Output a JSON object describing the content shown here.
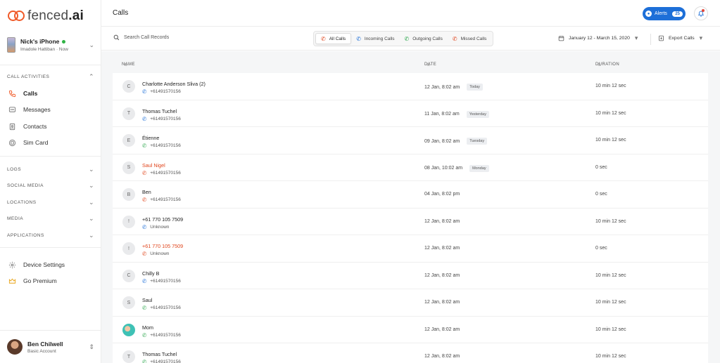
{
  "app": {
    "logo_text_light": "fenced",
    "logo_text_bold": ".ai"
  },
  "device": {
    "name": "Nick's iPhone",
    "owner": "Imadole Hattiban",
    "status": "Now"
  },
  "sidebar": {
    "call_activities_header": "CALL ACTIVITIES",
    "items": [
      {
        "label": "Calls",
        "icon": "phone-icon"
      },
      {
        "label": "Messages",
        "icon": "message-icon"
      },
      {
        "label": "Contacts",
        "icon": "contacts-icon"
      },
      {
        "label": "Sim Card",
        "icon": "sim-card-icon"
      }
    ],
    "sections": [
      "LOGS",
      "SOCIAL MEDIA",
      "LOCATIONS",
      "MEDIA",
      "APPLICATIONS"
    ],
    "bottom_items": [
      {
        "label": "Device Settings",
        "icon": "settings-icon"
      },
      {
        "label": "Go Premium",
        "icon": "crown-icon"
      }
    ]
  },
  "user": {
    "name": "Ben Chilwell",
    "plan": "Basic Account"
  },
  "header": {
    "title": "Calls",
    "alerts_label": "Alerts",
    "alerts_count": "25"
  },
  "filters": {
    "search_placeholder": "Search Call Records",
    "tabs": [
      "All Calls",
      "Incoming Calls",
      "Outgoing Calls",
      "Missed Calls"
    ],
    "date_range": "January 12 - March 15, 2020",
    "export_label": "Export Calls"
  },
  "table": {
    "columns": [
      "NAME",
      "DATE",
      "DURATION"
    ],
    "rows": [
      {
        "initial": "C",
        "name": "Charlotte Anderson Sliva (2)",
        "number": "+61491570156",
        "type": "incoming",
        "date": "12 Jan, 8:02 am",
        "tag": "Today",
        "duration": "10 min 12 sec"
      },
      {
        "initial": "T",
        "name": "Thomas Tuchel",
        "number": "+61491570156",
        "type": "incoming",
        "date": "11 Jan, 8:02 am",
        "tag": "Yesterday",
        "duration": "10 min 12 sec"
      },
      {
        "initial": "E",
        "name": "Étienne",
        "number": "+61491570156",
        "type": "outgoing",
        "date": "09 Jan, 8:02 am",
        "tag": "Tuesday",
        "duration": "10 min 12 sec"
      },
      {
        "initial": "S",
        "name": "Saul Nigel",
        "number": "+61491570156",
        "type": "missed",
        "date": "08 Jan, 10:02 am",
        "tag": "Monday",
        "duration": "0 sec"
      },
      {
        "initial": "B",
        "name": "Ben",
        "number": "+61491570156",
        "type": "missed-plain",
        "date": "04 Jan, 8:02 pm",
        "tag": "",
        "duration": "0 sec"
      },
      {
        "initial": "!",
        "name": "+61 770 105 7509",
        "number": "Unknown",
        "type": "incoming",
        "date": "12 Jan, 8:02 am",
        "tag": "",
        "duration": "10 min 12 sec"
      },
      {
        "initial": "!",
        "name": "+61 770 105 7509",
        "number": "Unknown",
        "type": "missed",
        "date": "12 Jan, 8:02 am",
        "tag": "",
        "duration": "0 sec"
      },
      {
        "initial": "C",
        "name": "Chilly B",
        "number": "+61491570156",
        "type": "incoming",
        "date": "12 Jan, 8:02 am",
        "tag": "",
        "duration": "10 min 12 sec"
      },
      {
        "initial": "S",
        "name": "Saul",
        "number": "+61491570156",
        "type": "outgoing",
        "date": "12 Jan, 8:02 am",
        "tag": "",
        "duration": "10 min 12 sec"
      },
      {
        "initial": "",
        "name": "Mom",
        "number": "+61491570156",
        "type": "outgoing",
        "date": "12 Jan, 8:02 am",
        "tag": "",
        "duration": "10 min 12 sec",
        "photo": true
      },
      {
        "initial": "T",
        "name": "Thomas Tuchel",
        "number": "+61491570156",
        "type": "outgoing",
        "date": "12 Jan, 8:02 am",
        "tag": "",
        "duration": "10 min 12 sec"
      }
    ]
  }
}
